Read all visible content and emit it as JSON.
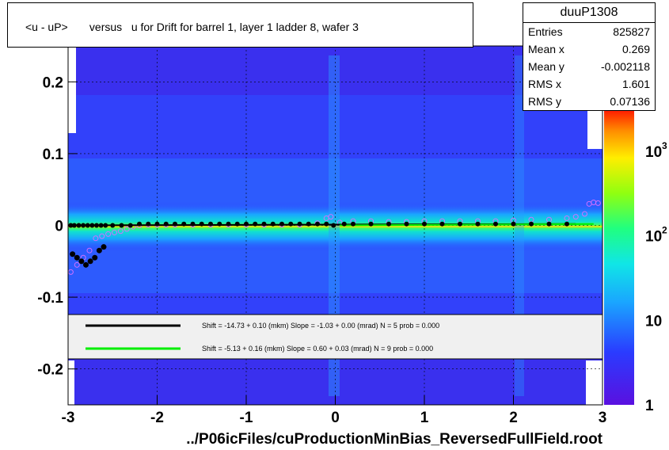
{
  "title": "<u - uP>       versus   u for Drift for barrel 1, layer 1 ladder 8, wafer 3",
  "stats": {
    "name": "duuP1308",
    "rows": [
      {
        "label": "Entries",
        "value": "825827"
      },
      {
        "label": "Mean x",
        "value": "0.269"
      },
      {
        "label": "Mean y",
        "value": "-0.002118"
      },
      {
        "label": "RMS x",
        "value": "1.601"
      },
      {
        "label": "RMS y",
        "value": "0.07136"
      }
    ]
  },
  "xlabel": "../P06icFiles/cuProductionMinBias_ReversedFullField.root",
  "colorbar": {
    "labels": [
      "1",
      "10",
      "10",
      "10"
    ],
    "exponent_labels": [
      "",
      "",
      "2",
      "3"
    ]
  },
  "legend": [
    {
      "color": "#000000",
      "text": "Shift =   -14.73 + 0.10 (mkm) Slope =    -1.03 + 0.00 (mrad)  N = 5 prob = 0.000"
    },
    {
      "color": "#00ee00",
      "text": "Shift =    -5.13 + 0.16 (mkm) Slope =     0.60 + 0.03 (mrad)  N = 9 prob = 0.000"
    }
  ],
  "chart_data": {
    "type": "heatmap",
    "xlim": [
      -3,
      3
    ],
    "ylim": [
      -0.25,
      0.25
    ],
    "x_ticks": [
      "-3",
      "-2",
      "-1",
      "0",
      "1",
      "2",
      "3"
    ],
    "y_ticks": [
      "-0.2",
      "-0.1",
      "0",
      "0.1",
      "0.2"
    ],
    "zscale": "log",
    "zlim": [
      1,
      3000
    ],
    "black_profile": {
      "x": [
        -2.97,
        -2.93,
        -2.88,
        -2.83,
        -2.78,
        -2.73,
        -2.68,
        -2.63,
        -2.58,
        -2.5,
        -2.4,
        -2.3,
        -2.2,
        -2.1,
        -2.0,
        -1.9,
        -1.8,
        -1.7,
        -1.6,
        -1.5,
        -1.4,
        -1.3,
        -1.2,
        -1.1,
        -1.0,
        -0.9,
        -0.8,
        -0.7,
        -0.6,
        -0.5,
        -0.4,
        -0.3,
        -0.2,
        -0.1,
        -0.02,
        0.1,
        0.2,
        0.4,
        0.6,
        0.8,
        1.0,
        1.2,
        1.4,
        1.6,
        1.8,
        2.0,
        2.2,
        2.4,
        2.6
      ],
      "y": [
        0.0,
        0.0,
        0.0,
        0.0,
        0.0,
        0.0,
        0.0,
        0.0,
        0.0,
        0.0,
        0.0,
        0.0,
        0.002,
        0.002,
        0.002,
        0.002,
        0.002,
        0.002,
        0.002,
        0.002,
        0.002,
        0.002,
        0.002,
        0.002,
        0.002,
        0.002,
        0.002,
        0.002,
        0.002,
        0.002,
        0.002,
        0.002,
        0.002,
        0.002,
        0.0,
        0.002,
        0.002,
        0.002,
        0.002,
        0.002,
        0.002,
        0.002,
        0.002,
        0.002,
        0.002,
        0.002,
        0.002,
        0.002,
        0.002
      ]
    },
    "black_outliers": {
      "x": [
        -2.95,
        -2.9,
        -2.85,
        -2.8,
        -2.75,
        -2.7,
        -2.65,
        -2.6
      ],
      "y": [
        -0.04,
        -0.045,
        -0.05,
        -0.055,
        -0.05,
        -0.045,
        -0.035,
        -0.03
      ]
    },
    "open_profile": {
      "x": [
        -2.97,
        -2.9,
        -2.83,
        -2.76,
        -2.69,
        -2.62,
        -2.55,
        -2.48,
        -2.41,
        -2.34,
        -2.27,
        -2.2,
        -2.1,
        -2.0,
        -1.9,
        -1.8,
        -1.6,
        -1.4,
        -1.2,
        -1.0,
        -0.8,
        -0.6,
        -0.4,
        -0.2,
        -0.1,
        -0.05,
        0.05,
        0.2,
        0.4,
        0.6,
        0.8,
        1.0,
        1.2,
        1.4,
        1.6,
        1.8,
        2.0,
        2.2,
        2.4,
        2.6,
        2.7,
        2.8,
        2.85,
        2.9,
        2.95
      ],
      "y": [
        -0.065,
        -0.055,
        -0.045,
        -0.035,
        -0.018,
        -0.015,
        -0.012,
        -0.01,
        -0.008,
        -0.005,
        -0.002,
        0.0,
        0.001,
        0.001,
        0.001,
        0.001,
        0.001,
        0.001,
        0.001,
        0.001,
        0.001,
        0.001,
        0.001,
        0.003,
        0.01,
        0.012,
        0.004,
        0.006,
        0.006,
        0.005,
        0.005,
        0.006,
        0.006,
        0.006,
        0.006,
        0.006,
        0.007,
        0.008,
        0.008,
        0.01,
        0.012,
        0.016,
        0.03,
        0.032,
        0.031
      ]
    }
  }
}
